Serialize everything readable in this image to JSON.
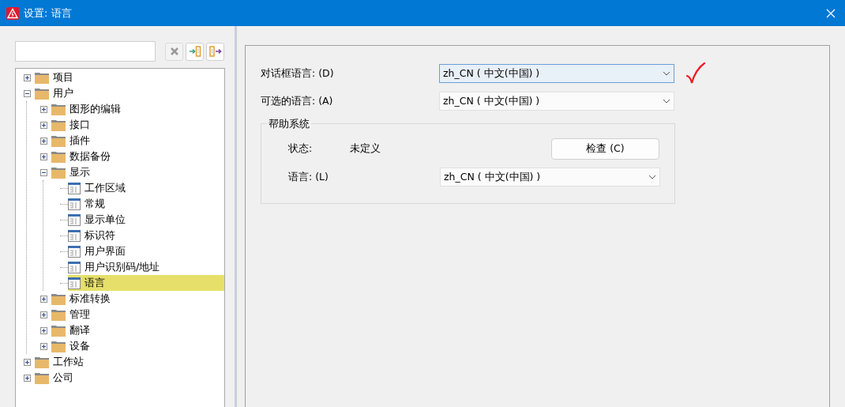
{
  "window": {
    "title": "设置: 语言"
  },
  "tree": [
    {
      "label": "项目",
      "kind": "folder",
      "expanded": false,
      "selected": false
    },
    {
      "label": "用户",
      "kind": "folder",
      "expanded": true,
      "selected": false,
      "children": [
        {
          "label": "图形的编辑",
          "kind": "folder",
          "expanded": false,
          "selected": false
        },
        {
          "label": "接口",
          "kind": "folder",
          "expanded": false,
          "selected": false
        },
        {
          "label": "插件",
          "kind": "folder",
          "expanded": false,
          "selected": false
        },
        {
          "label": "数据备份",
          "kind": "folder",
          "expanded": false,
          "selected": false
        },
        {
          "label": "显示",
          "kind": "folder",
          "expanded": true,
          "selected": false,
          "children": [
            {
              "label": "工作区域",
              "kind": "page",
              "selected": false
            },
            {
              "label": "常规",
              "kind": "page",
              "selected": false
            },
            {
              "label": "显示单位",
              "kind": "page",
              "selected": false
            },
            {
              "label": "标识符",
              "kind": "page",
              "selected": false
            },
            {
              "label": "用户界面",
              "kind": "page",
              "selected": false
            },
            {
              "label": "用户识别码/地址",
              "kind": "page",
              "selected": false
            },
            {
              "label": "语言",
              "kind": "page",
              "selected": true
            }
          ]
        },
        {
          "label": "标准转换",
          "kind": "folder",
          "expanded": false,
          "selected": false
        },
        {
          "label": "管理",
          "kind": "folder",
          "expanded": false,
          "selected": false
        },
        {
          "label": "翻译",
          "kind": "folder",
          "expanded": false,
          "selected": false
        },
        {
          "label": "设备",
          "kind": "folder",
          "expanded": false,
          "selected": false
        }
      ]
    },
    {
      "label": "工作站",
      "kind": "folder",
      "expanded": false,
      "selected": false
    },
    {
      "label": "公司",
      "kind": "folder",
      "expanded": false,
      "selected": false
    }
  ],
  "settings": [
    {
      "label": "对话框语言: (D)",
      "value": "zh_CN ( 中文(中国) )",
      "focused": true
    },
    {
      "label": "可选的语言: (A)",
      "value": "zh_CN ( 中文(中国) )",
      "focused": false
    }
  ],
  "help_system": {
    "title": "帮助系统",
    "status_label": "状态:",
    "status_value": "未定义",
    "check_button": "检查 (C)",
    "language_label": "语言: (L)",
    "language_value": "zh_CN ( 中文(中国) )"
  }
}
